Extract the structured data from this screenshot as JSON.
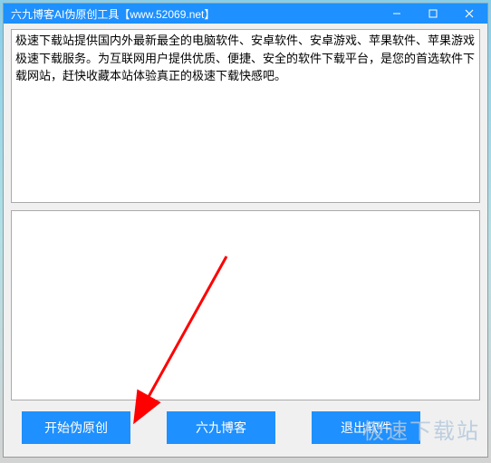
{
  "window": {
    "title": "六九博客AI伪原创工具【www.52069.net】"
  },
  "input": {
    "text": "极速下载站提供国内外最新最全的电脑软件、安卓软件、安卓游戏、苹果软件、苹果游戏极速下载服务。为互联网用户提供优质、便捷、安全的软件下载平台，是您的首选软件下载网站，赶快收藏本站体验真正的极速下载快感吧。"
  },
  "output": {
    "text": ""
  },
  "buttons": {
    "start": "开始伪原创",
    "blog": "六九博客",
    "exit": "退出软件"
  },
  "watermark": "极速下载站"
}
